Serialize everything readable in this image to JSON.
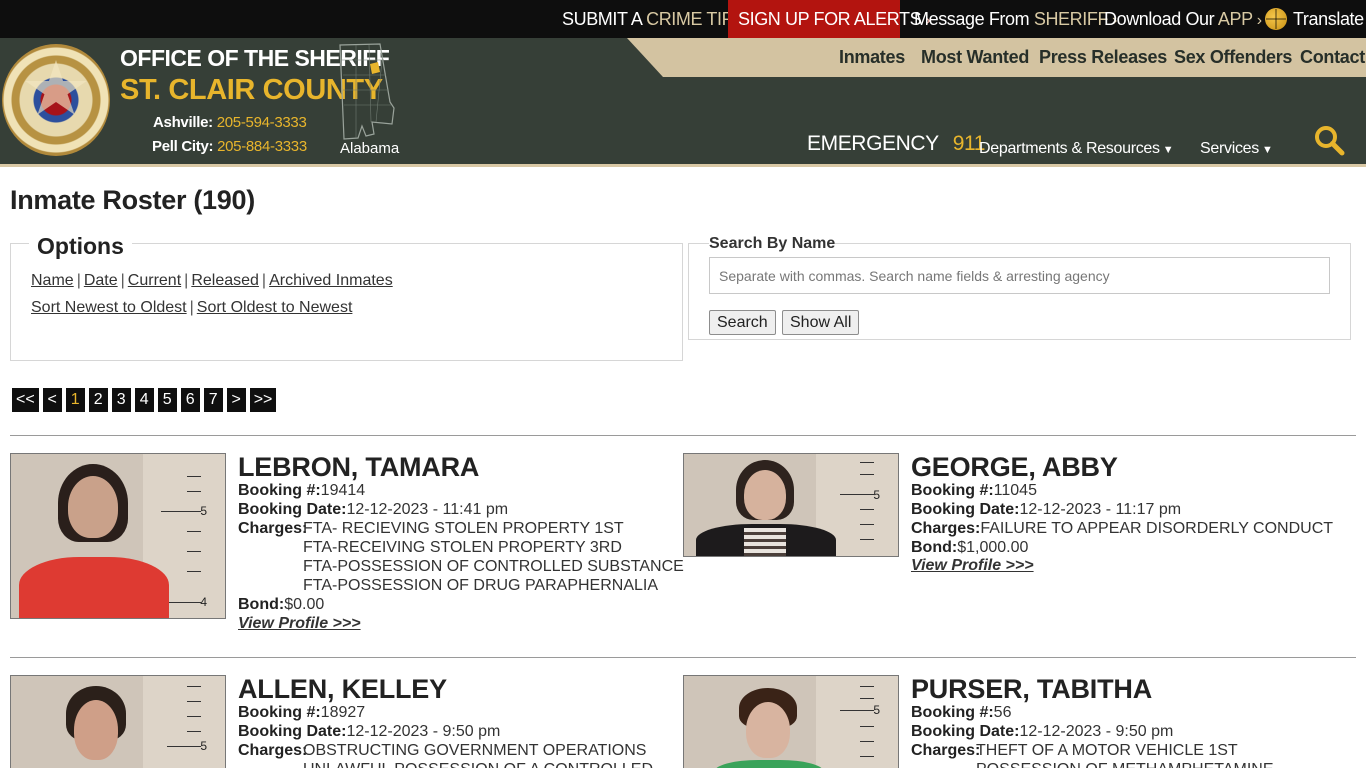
{
  "topbar": {
    "crime_tip": {
      "prefix": "SUBMIT A",
      "accent": "CRIME TIP"
    },
    "alerts": {
      "text": "SIGN UP FOR ALERTS"
    },
    "message": {
      "prefix": "Message From",
      "accent": "SHERIFF"
    },
    "app": {
      "prefix": "Download Our",
      "accent": "APP"
    },
    "translate": "Translate",
    "chevron": "›"
  },
  "header": {
    "office_title": "OFFICE OF THE SHERIFF",
    "county_title": "ST. CLAIR COUNTY",
    "phones": [
      {
        "label": "Ashville:",
        "number": "205-594-3333"
      },
      {
        "label": "Pell City:",
        "number": "205-884-3333"
      }
    ],
    "state_label": "Alabama",
    "emergency": {
      "label": "EMERGENCY",
      "number": "911"
    },
    "nav": [
      "Inmates",
      "Most Wanted",
      "Press Releases",
      "Sex Offenders",
      "Contact"
    ],
    "dropdowns": [
      "Departments & Resources",
      "Services"
    ],
    "caret": "⌄"
  },
  "page": {
    "title": "Inmate Roster (190)"
  },
  "options": {
    "legend": "Options",
    "filters": [
      "Name",
      "Date",
      "Current",
      "Released",
      "Archived Inmates"
    ],
    "sorts": [
      "Sort Newest to Oldest",
      "Sort Oldest to Newest"
    ],
    "separator": "|"
  },
  "search": {
    "label": "Search By Name",
    "placeholder": "Separate with commas. Search name fields & arresting agency",
    "value": "",
    "search_label": "Search",
    "show_all_label": "Show All"
  },
  "pagination": {
    "first": "<<",
    "prev": "<",
    "pages": [
      "1",
      "2",
      "3",
      "4",
      "5",
      "6",
      "7"
    ],
    "current": "1",
    "next": ">",
    "last": ">>"
  },
  "labels": {
    "booking_no": "Booking #:",
    "booking_date": "Booking Date:",
    "charges": "Charges:",
    "bond": "Bond:",
    "view_profile": "View Profile >>>"
  },
  "inmates": [
    {
      "name": "LEBRON, TAMARA",
      "booking_no": "19414",
      "booking_date": "12-12-2023 - 11:41 pm",
      "charges": [
        "FTA- RECIEVING STOLEN PROPERTY 1ST",
        "FTA-RECEIVING STOLEN PROPERTY 3RD",
        "FTA-POSSESSION OF CONTROLLED SUBSTANCE",
        "FTA-POSSESSION OF DRUG PARAPHERNALIA"
      ],
      "bond": "$0.00",
      "scale_marks": [
        "5",
        "4"
      ]
    },
    {
      "name": "GEORGE, ABBY",
      "booking_no": "11045",
      "booking_date": "12-12-2023 - 11:17 pm",
      "charges": [
        "FAILURE TO APPEAR DISORDERLY CONDUCT"
      ],
      "bond": "$1,000.00",
      "scale_marks": [
        "5"
      ]
    },
    {
      "name": "ALLEN, KELLEY",
      "booking_no": "18927",
      "booking_date": "12-12-2023 - 9:50 pm",
      "charges": [
        "OBSTRUCTING GOVERNMENT OPERATIONS",
        "UNLAWFUL POSSESSION OF A CONTROLLED"
      ],
      "bond": "",
      "scale_marks": [
        "5"
      ]
    },
    {
      "name": "PURSER, TABITHA",
      "booking_no": "56",
      "booking_date": "12-12-2023 - 9:50 pm",
      "charges": [
        "THEFT OF A MOTOR VEHICLE 1ST",
        "POSSESSION OF METHAMPHETAMINE"
      ],
      "bond": "",
      "scale_marks": [
        "5"
      ]
    }
  ],
  "colors": {
    "header_bg": "#363f37",
    "accent_gold": "#e8b52c",
    "nav_tan": "#d3c3a1",
    "alert_red": "#b3140f"
  }
}
